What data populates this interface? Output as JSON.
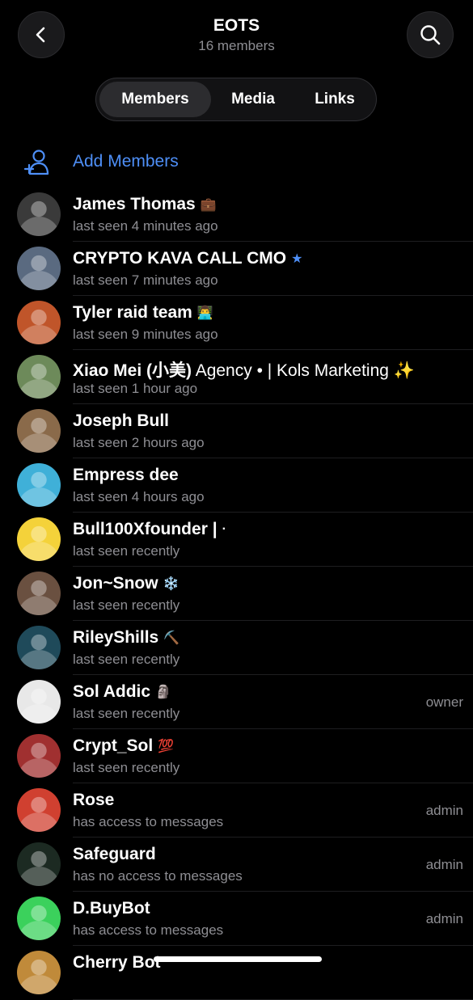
{
  "header": {
    "title": "EOTS",
    "subtitle": "16 members",
    "back_icon": "chevron-left-icon",
    "search_icon": "magnifier-icon"
  },
  "tabs": [
    {
      "label": "Members",
      "active": true
    },
    {
      "label": "Media",
      "active": false
    },
    {
      "label": "Links",
      "active": false
    }
  ],
  "add_members": {
    "label": "Add Members",
    "color": "#4e8ff7"
  },
  "members": [
    {
      "name": "James Thomas",
      "extra": "",
      "badge": "💼",
      "status": "last seen 4 minutes ago",
      "role": "",
      "avatar_color": "#3a3a3a"
    },
    {
      "name": "CRYPTO KAVA CALL CMO",
      "extra": "",
      "badge": "★",
      "status": "last seen 7 minutes ago",
      "role": "",
      "avatar_color": "#5a6a80"
    },
    {
      "name": "Tyler raid team",
      "extra": "",
      "badge": "👨‍💻",
      "status": "last seen 9 minutes ago",
      "role": "",
      "avatar_color": "#c0552a"
    },
    {
      "name": "Xiao Mei (小美)",
      "extra": " Agency • | Kols Marketing ✨",
      "badge": "",
      "status": "last seen 1 hour ago",
      "role": "",
      "avatar_color": "#6d8a5a"
    },
    {
      "name": "Joseph Bull",
      "extra": "",
      "badge": "",
      "status": "last seen 2 hours ago",
      "role": "",
      "avatar_color": "#8a6a4a"
    },
    {
      "name": "Empress dee",
      "extra": "",
      "badge": "",
      "status": "last seen 4 hours ago",
      "role": "",
      "avatar_color": "#3fb0d8"
    },
    {
      "name": "Bull100Xfounder |",
      "extra": "",
      "badge": "·",
      "status": "last seen recently",
      "role": "",
      "avatar_color": "#f4d23a"
    },
    {
      "name": "Jon~Snow",
      "extra": "",
      "badge": "❄️",
      "status": "last seen recently",
      "role": "",
      "avatar_color": "#6a5040"
    },
    {
      "name": "RileyShills",
      "extra": "",
      "badge": "⛏️",
      "status": "last seen recently",
      "role": "",
      "avatar_color": "#1f4a5a"
    },
    {
      "name": "Sol Addic",
      "extra": "",
      "badge": "🗿",
      "status": "last seen recently",
      "role": "owner",
      "avatar_color": "#e8e8e8"
    },
    {
      "name": "Crypt_Sol",
      "extra": "",
      "badge": "💯",
      "status": "last seen recently",
      "role": "",
      "avatar_color": "#a03030"
    },
    {
      "name": "Rose",
      "extra": "",
      "badge": "",
      "status": "has access to messages",
      "role": "admin",
      "avatar_color": "#d04030"
    },
    {
      "name": "Safeguard",
      "extra": "",
      "badge": "",
      "status": "has no access to messages",
      "role": "admin",
      "avatar_color": "#1c2a22"
    },
    {
      "name": "D.BuyBot",
      "extra": "",
      "badge": "",
      "status": "has access to messages",
      "role": "admin",
      "avatar_color": "#3bd15c"
    },
    {
      "name": "Cherry Bot",
      "extra": "",
      "badge": "",
      "status": "",
      "role": "",
      "avatar_color": "#c08a3a"
    }
  ]
}
